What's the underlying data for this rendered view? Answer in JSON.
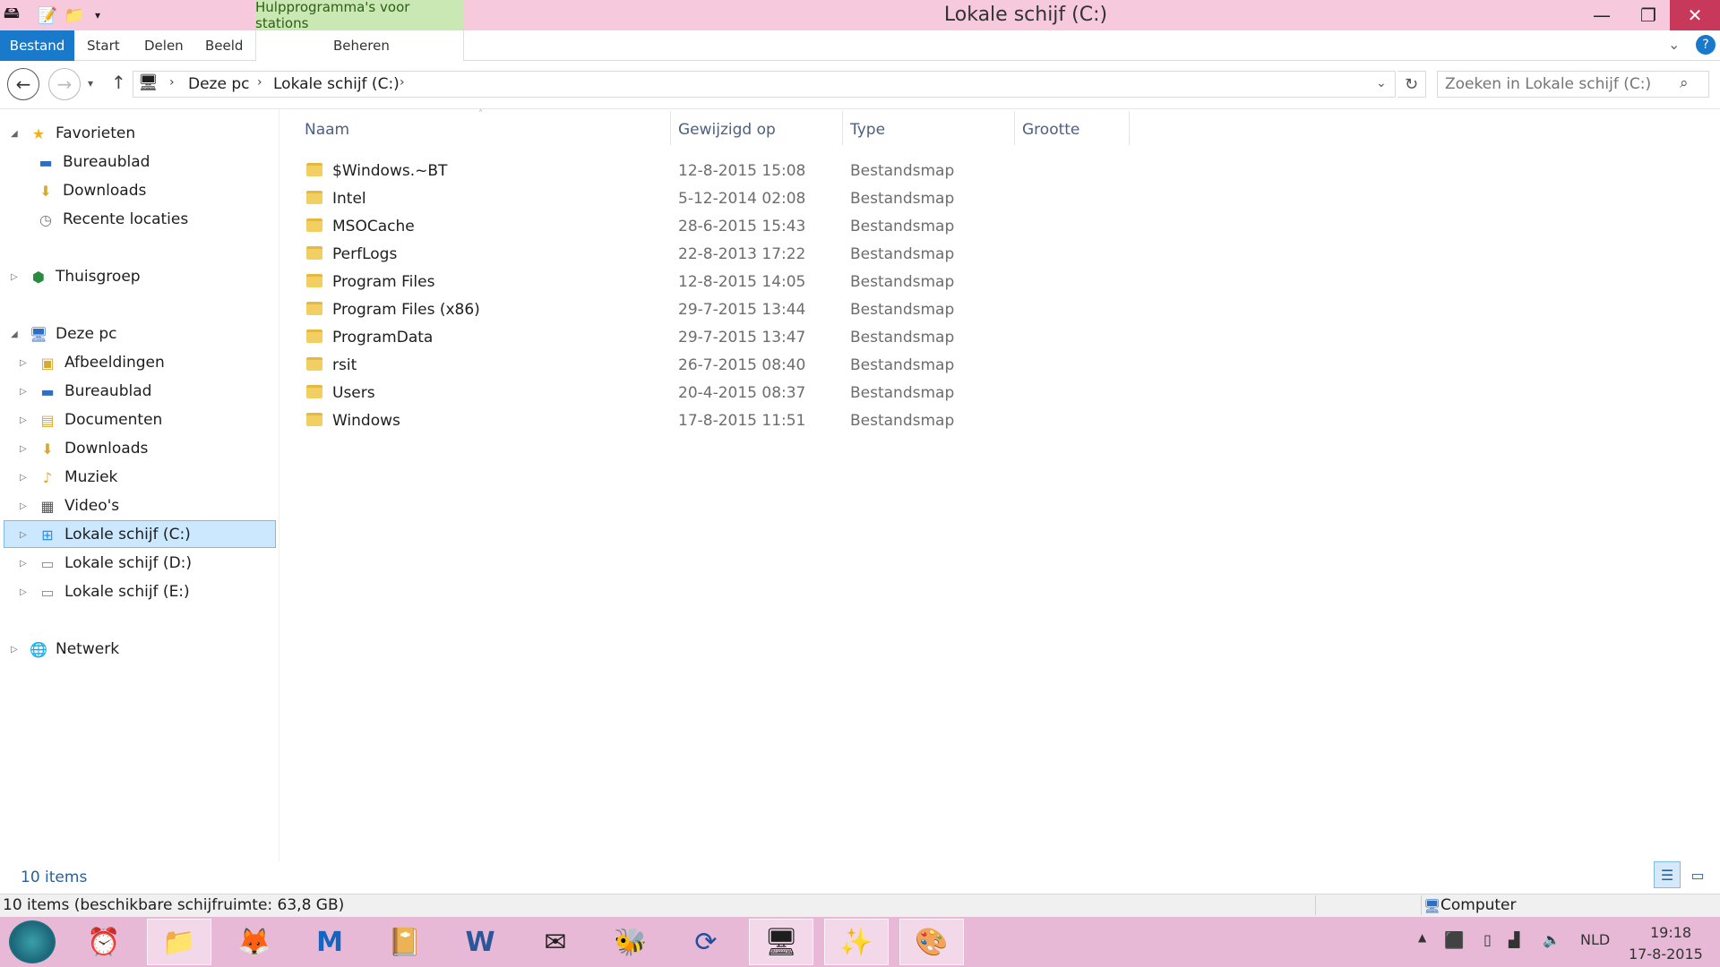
{
  "window": {
    "title": "Lokale schijf (C:)",
    "context_tab_header": "Hulpprogramma's voor stations",
    "minimize": "—",
    "maximize": "❐",
    "close": "✕"
  },
  "ribbon": {
    "tabs": [
      "Bestand",
      "Start",
      "Delen",
      "Beeld",
      "Beheren"
    ]
  },
  "address": {
    "crumbs": [
      "Deze pc",
      "Lokale schijf (C:)"
    ],
    "search_placeholder": "Zoeken in Lokale schijf (C:)"
  },
  "nav": {
    "favorites": {
      "label": "Favorieten",
      "items": [
        "Bureaublad",
        "Downloads",
        "Recente locaties"
      ]
    },
    "homegroup": "Thuisgroep",
    "this_pc": {
      "label": "Deze pc",
      "items": [
        "Afbeeldingen",
        "Bureaublad",
        "Documenten",
        "Downloads",
        "Muziek",
        "Video's",
        "Lokale schijf (C:)",
        "Lokale schijf (D:)",
        "Lokale schijf (E:)"
      ]
    },
    "network": "Netwerk"
  },
  "columns": [
    "Naam",
    "Gewijzigd op",
    "Type",
    "Grootte"
  ],
  "files": [
    {
      "name": "$Windows.~BT",
      "modified": "12-8-2015 15:08",
      "type": "Bestandsmap"
    },
    {
      "name": "Intel",
      "modified": "5-12-2014 02:08",
      "type": "Bestandsmap"
    },
    {
      "name": "MSOCache",
      "modified": "28-6-2015 15:43",
      "type": "Bestandsmap"
    },
    {
      "name": "PerfLogs",
      "modified": "22-8-2013 17:22",
      "type": "Bestandsmap"
    },
    {
      "name": "Program Files",
      "modified": "12-8-2015 14:05",
      "type": "Bestandsmap"
    },
    {
      "name": "Program Files (x86)",
      "modified": "29-7-2015 13:44",
      "type": "Bestandsmap"
    },
    {
      "name": "ProgramData",
      "modified": "29-7-2015 13:47",
      "type": "Bestandsmap"
    },
    {
      "name": "rsit",
      "modified": "26-7-2015 08:40",
      "type": "Bestandsmap"
    },
    {
      "name": "Users",
      "modified": "20-4-2015 08:37",
      "type": "Bestandsmap"
    },
    {
      "name": "Windows",
      "modified": "17-8-2015 11:51",
      "type": "Bestandsmap"
    }
  ],
  "status": {
    "item_count": "10 items",
    "bar_text": "10 items (beschikbare schijfruimte: 63,8 GB)",
    "location": "Computer"
  },
  "taskbar": {
    "language": "NLD",
    "time": "19:18",
    "date": "17-8-2015"
  }
}
